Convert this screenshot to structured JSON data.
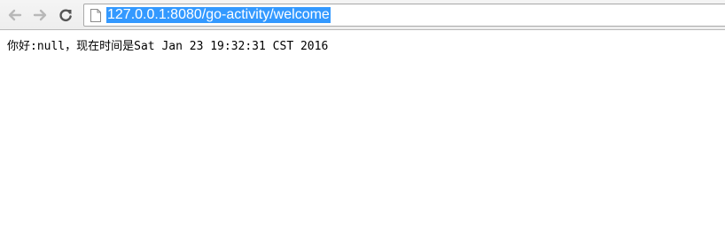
{
  "browser": {
    "toolbar": {
      "back_icon": "arrow-left-icon",
      "forward_icon": "arrow-right-icon",
      "reload_icon": "reload-icon",
      "page_icon": "page-icon"
    },
    "address_bar": {
      "url": "127.0.0.1:8080/go-activity/welcome",
      "selected": true,
      "selection_color": "#3399ff"
    }
  },
  "page": {
    "message": "你好:null，现在时间是Sat Jan 23 19:32:31 CST 2016"
  }
}
